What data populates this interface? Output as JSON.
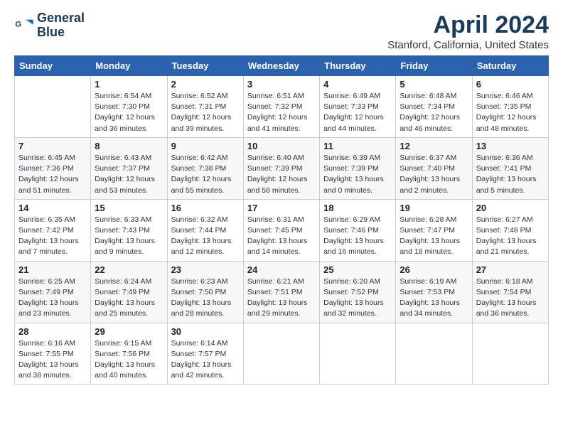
{
  "logo": {
    "line1": "General",
    "line2": "Blue"
  },
  "title": "April 2024",
  "subtitle": "Stanford, California, United States",
  "weekdays": [
    "Sunday",
    "Monday",
    "Tuesday",
    "Wednesday",
    "Thursday",
    "Friday",
    "Saturday"
  ],
  "weeks": [
    [
      null,
      {
        "day": "1",
        "sunrise": "6:54 AM",
        "sunset": "7:30 PM",
        "daylight": "12 hours and 36 minutes."
      },
      {
        "day": "2",
        "sunrise": "6:52 AM",
        "sunset": "7:31 PM",
        "daylight": "12 hours and 39 minutes."
      },
      {
        "day": "3",
        "sunrise": "6:51 AM",
        "sunset": "7:32 PM",
        "daylight": "12 hours and 41 minutes."
      },
      {
        "day": "4",
        "sunrise": "6:49 AM",
        "sunset": "7:33 PM",
        "daylight": "12 hours and 44 minutes."
      },
      {
        "day": "5",
        "sunrise": "6:48 AM",
        "sunset": "7:34 PM",
        "daylight": "12 hours and 46 minutes."
      },
      {
        "day": "6",
        "sunrise": "6:46 AM",
        "sunset": "7:35 PM",
        "daylight": "12 hours and 48 minutes."
      }
    ],
    [
      {
        "day": "7",
        "sunrise": "6:45 AM",
        "sunset": "7:36 PM",
        "daylight": "12 hours and 51 minutes."
      },
      {
        "day": "8",
        "sunrise": "6:43 AM",
        "sunset": "7:37 PM",
        "daylight": "12 hours and 53 minutes."
      },
      {
        "day": "9",
        "sunrise": "6:42 AM",
        "sunset": "7:38 PM",
        "daylight": "12 hours and 55 minutes."
      },
      {
        "day": "10",
        "sunrise": "6:40 AM",
        "sunset": "7:39 PM",
        "daylight": "12 hours and 58 minutes."
      },
      {
        "day": "11",
        "sunrise": "6:39 AM",
        "sunset": "7:39 PM",
        "daylight": "13 hours and 0 minutes."
      },
      {
        "day": "12",
        "sunrise": "6:37 AM",
        "sunset": "7:40 PM",
        "daylight": "13 hours and 2 minutes."
      },
      {
        "day": "13",
        "sunrise": "6:36 AM",
        "sunset": "7:41 PM",
        "daylight": "13 hours and 5 minutes."
      }
    ],
    [
      {
        "day": "14",
        "sunrise": "6:35 AM",
        "sunset": "7:42 PM",
        "daylight": "13 hours and 7 minutes."
      },
      {
        "day": "15",
        "sunrise": "6:33 AM",
        "sunset": "7:43 PM",
        "daylight": "13 hours and 9 minutes."
      },
      {
        "day": "16",
        "sunrise": "6:32 AM",
        "sunset": "7:44 PM",
        "daylight": "13 hours and 12 minutes."
      },
      {
        "day": "17",
        "sunrise": "6:31 AM",
        "sunset": "7:45 PM",
        "daylight": "13 hours and 14 minutes."
      },
      {
        "day": "18",
        "sunrise": "6:29 AM",
        "sunset": "7:46 PM",
        "daylight": "13 hours and 16 minutes."
      },
      {
        "day": "19",
        "sunrise": "6:28 AM",
        "sunset": "7:47 PM",
        "daylight": "13 hours and 18 minutes."
      },
      {
        "day": "20",
        "sunrise": "6:27 AM",
        "sunset": "7:48 PM",
        "daylight": "13 hours and 21 minutes."
      }
    ],
    [
      {
        "day": "21",
        "sunrise": "6:25 AM",
        "sunset": "7:49 PM",
        "daylight": "13 hours and 23 minutes."
      },
      {
        "day": "22",
        "sunrise": "6:24 AM",
        "sunset": "7:49 PM",
        "daylight": "13 hours and 25 minutes."
      },
      {
        "day": "23",
        "sunrise": "6:23 AM",
        "sunset": "7:50 PM",
        "daylight": "13 hours and 28 minutes."
      },
      {
        "day": "24",
        "sunrise": "6:21 AM",
        "sunset": "7:51 PM",
        "daylight": "13 hours and 29 minutes."
      },
      {
        "day": "25",
        "sunrise": "6:20 AM",
        "sunset": "7:52 PM",
        "daylight": "13 hours and 32 minutes."
      },
      {
        "day": "26",
        "sunrise": "6:19 AM",
        "sunset": "7:53 PM",
        "daylight": "13 hours and 34 minutes."
      },
      {
        "day": "27",
        "sunrise": "6:18 AM",
        "sunset": "7:54 PM",
        "daylight": "13 hours and 36 minutes."
      }
    ],
    [
      {
        "day": "28",
        "sunrise": "6:16 AM",
        "sunset": "7:55 PM",
        "daylight": "13 hours and 38 minutes."
      },
      {
        "day": "29",
        "sunrise": "6:15 AM",
        "sunset": "7:56 PM",
        "daylight": "13 hours and 40 minutes."
      },
      {
        "day": "30",
        "sunrise": "6:14 AM",
        "sunset": "7:57 PM",
        "daylight": "13 hours and 42 minutes."
      },
      null,
      null,
      null,
      null
    ]
  ]
}
